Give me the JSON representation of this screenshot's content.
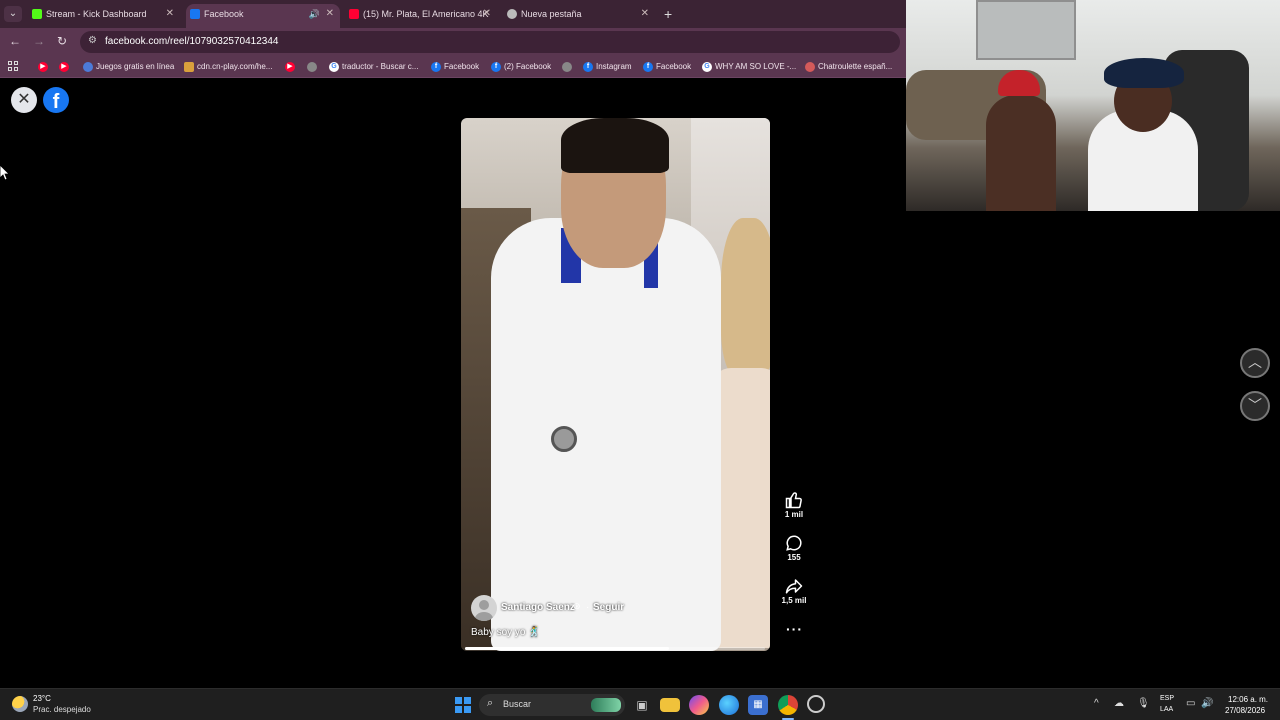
{
  "browser": {
    "tabs": [
      {
        "title": "Stream - Kick Dashboard",
        "favicon_color": "#53fc18",
        "icon": "kick-icon"
      },
      {
        "title": "Facebook",
        "favicon_color": "#1877f2",
        "icon": "facebook-icon"
      },
      {
        "title": "(15) Mr. Plata, El Americano 4K",
        "favicon_color": "#ff0033",
        "icon": "youtube-icon"
      },
      {
        "title": "Nueva pestaña",
        "favicon_color": "#bbbbbb",
        "icon": "chrome-icon"
      }
    ],
    "url": "facebook.com/reel/1079032570412344",
    "bookmarks": [
      {
        "label": "",
        "color": "#ff0033",
        "icon": "youtube-icon"
      },
      {
        "label": "",
        "color": "#ff0033",
        "icon": "youtube-icon"
      },
      {
        "label": "Juegos gratis en línea",
        "color": "#4c7bd9",
        "icon": "games-icon"
      },
      {
        "label": "cdn.cn-play.com/he...",
        "color": "#d9a03c",
        "icon": "site-icon"
      },
      {
        "label": "",
        "color": "#ff0033",
        "icon": "youtube-icon"
      },
      {
        "label": "",
        "color": "#888888",
        "icon": "globe-icon"
      },
      {
        "label": "traductor - Buscar c...",
        "color": "#ffffff",
        "icon": "google-icon"
      },
      {
        "label": "Facebook",
        "color": "#1877f2",
        "icon": "facebook-icon"
      },
      {
        "label": "(2) Facebook",
        "color": "#1877f2",
        "icon": "facebook-icon"
      },
      {
        "label": "",
        "color": "#888888",
        "icon": "globe-icon"
      },
      {
        "label": "Instagram",
        "color": "#1877f2",
        "icon": "facebook-icon"
      },
      {
        "label": "Facebook",
        "color": "#1877f2",
        "icon": "facebook-icon"
      },
      {
        "label": "WHY AM SO LOVE -...",
        "color": "#ffffff",
        "icon": "google-icon"
      },
      {
        "label": "Chatroulette españ...",
        "color": "#d45a5a",
        "icon": "chatroulette-icon"
      }
    ]
  },
  "reel": {
    "author": "Santiago Saenz",
    "follow_sep": "·",
    "follow_label": "Seguir",
    "caption": "Baby soy yo 🕺",
    "progress": 0.68,
    "likes": "1 mil",
    "comments": "155",
    "shares": "1,5 mil",
    "more": "···"
  },
  "taskbar": {
    "temperature": "23°C",
    "weather": "Prac. despejado",
    "search_label": "Buscar",
    "lang_top": "ESP",
    "lang_bottom": "LAA",
    "time": "12:06 a. m.",
    "date": "27/08/2026"
  }
}
